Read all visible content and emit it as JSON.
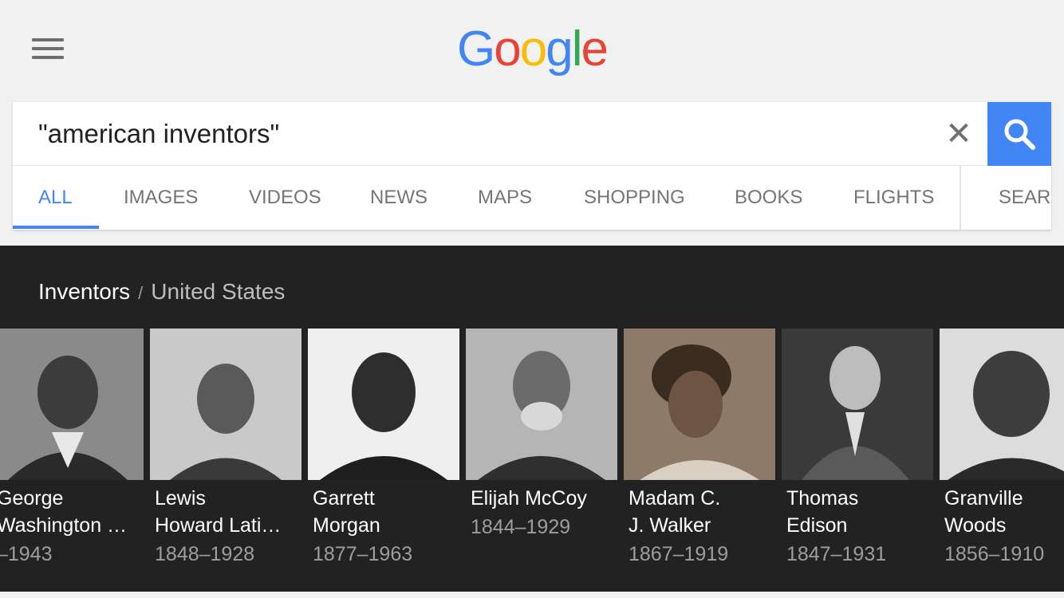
{
  "header": {
    "menu_icon": "hamburger-menu-icon"
  },
  "logo": {
    "letters": [
      "G",
      "o",
      "o",
      "g",
      "l",
      "e"
    ],
    "colors": [
      "#4285f4",
      "#ea4335",
      "#fbbc05",
      "#4285f4",
      "#34a853",
      "#ea4335"
    ]
  },
  "search": {
    "query": "\"american inventors\"",
    "clear_label": "✕",
    "accent": "#4285f4"
  },
  "tabs": [
    {
      "label": "ALL"
    },
    {
      "label": "IMAGES"
    },
    {
      "label": "VIDEOS"
    },
    {
      "label": "NEWS"
    },
    {
      "label": "MAPS"
    },
    {
      "label": "SHOPPING"
    },
    {
      "label": "BOOKS"
    },
    {
      "label": "FLIGHTS"
    },
    {
      "label": "SEAR"
    }
  ],
  "breadcrumb": {
    "parent": "Inventors",
    "separator": "/",
    "current": "United States"
  },
  "people": [
    {
      "name": "George\nWashington …",
      "years": "–1943"
    },
    {
      "name": "Lewis\nHoward Lati…",
      "years": "1848–1928"
    },
    {
      "name": "Garrett\nMorgan",
      "years": "1877–1963"
    },
    {
      "name": "Elijah McCoy",
      "years": "1844–1929"
    },
    {
      "name": "Madam C.\nJ. Walker",
      "years": "1867–1919"
    },
    {
      "name": "Thomas\nEdison",
      "years": "1847–1931"
    },
    {
      "name": "Granville\nWoods",
      "years": "1856–1910"
    }
  ]
}
